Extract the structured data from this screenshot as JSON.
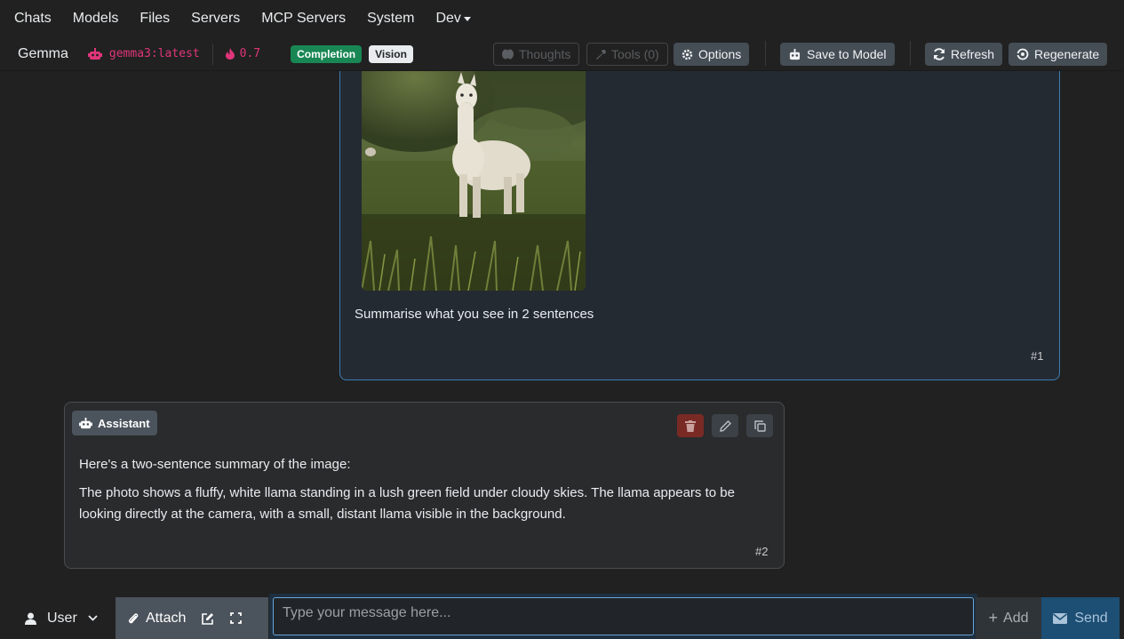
{
  "nav": {
    "items": [
      "Chats",
      "Models",
      "Files",
      "Servers",
      "MCP Servers",
      "System"
    ],
    "dev_label": "Dev"
  },
  "modelbar": {
    "name": "Gemma",
    "model_id": "gemma3:latest",
    "temperature": "0.7",
    "badge_completion": "Completion",
    "badge_vision": "Vision",
    "thoughts_label": "Thoughts",
    "tools_label": "Tools (0)",
    "options_label": "Options",
    "save_label": "Save to Model",
    "refresh_label": "Refresh",
    "regenerate_label": "Regenerate"
  },
  "messages": {
    "user": {
      "text": "Summarise what you see in 2 sentences",
      "number": "#1"
    },
    "assistant": {
      "role_label": "Assistant",
      "paragraphs": [
        "Here's a two-sentence summary of the image:",
        "The photo shows a fluffy, white llama standing in a lush green field under cloudy skies. The llama appears to be looking directly at the camera, with a small, distant llama visible in the background."
      ],
      "number": "#2"
    }
  },
  "composer": {
    "role": "User",
    "attach_label": "Attach",
    "placeholder": "Type your message here...",
    "add_label": "Add",
    "send_label": "Send"
  },
  "colors": {
    "accent_blue": "#3b7db3",
    "pink": "#e0357a",
    "green_badge": "#198754",
    "delete_red": "#7a2a25"
  }
}
